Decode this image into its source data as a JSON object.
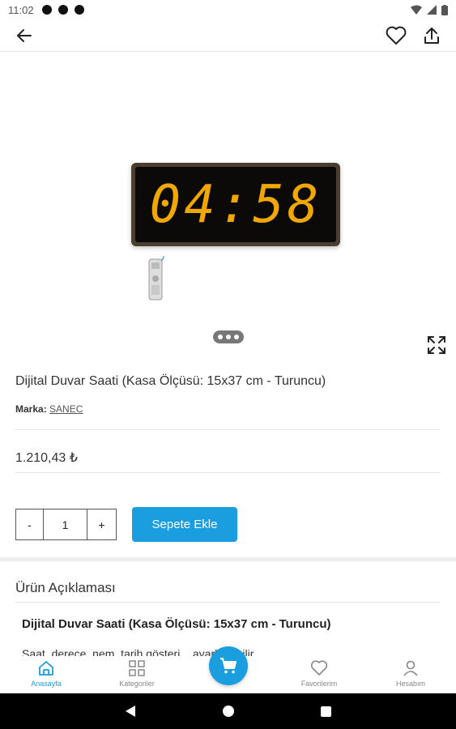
{
  "status_bar": {
    "time": "11:02"
  },
  "product": {
    "clock_display": "04:58",
    "title": "Dijital Duvar Saati (Kasa Ölçüsü: 15x37 cm - Turuncu)",
    "brand_label": "Marka:",
    "brand_name": "SANEC",
    "price": "1.210,43 ₺",
    "quantity": "1",
    "minus_label": "-",
    "plus_label": "+",
    "add_to_cart_label": "Sepete Ekle"
  },
  "description": {
    "heading": "Ürün Açıklaması",
    "title": "Dijital Duvar Saati (Kasa Ölçüsü: 15x37 cm - Turuncu)",
    "text": "Saat, derece, nem, tarih gösteri... ayarlanabilir..."
  },
  "bottom_nav": {
    "items": [
      {
        "label": "Anasayfa",
        "icon": "home-icon"
      },
      {
        "label": "Kategoriler",
        "icon": "grid-icon"
      },
      {
        "label": "",
        "icon": "cart-icon"
      },
      {
        "label": "Favorilerim",
        "icon": "heart-icon"
      },
      {
        "label": "Hesabım",
        "icon": "user-icon"
      }
    ]
  },
  "colors": {
    "accent": "#1a9ee0",
    "clock_digits": "#f0a800"
  }
}
